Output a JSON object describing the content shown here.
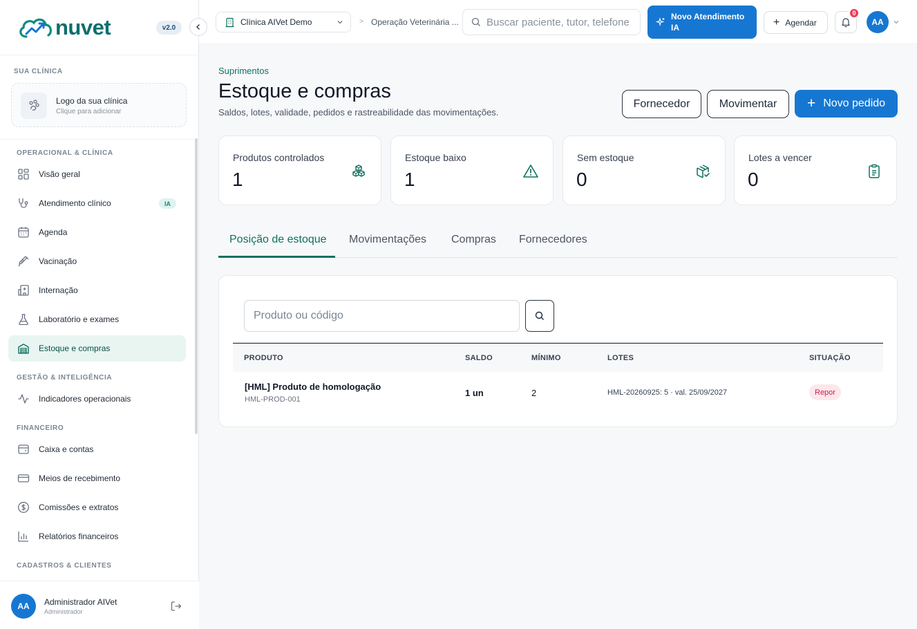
{
  "brand": {
    "name": "nuvet",
    "version": "v2.0"
  },
  "sidebar": {
    "clinic_section": "SUA CLÍNICA",
    "clinic_logo": {
      "title": "Logo da sua clínica",
      "subtitle": "Clique para adicionar"
    },
    "sections": [
      {
        "label": "OPERACIONAL & CLÍNICA",
        "items": [
          {
            "label": "Visão geral",
            "icon": "grid-icon"
          },
          {
            "label": "Atendimento clínico",
            "icon": "stethoscope-icon",
            "badge": "IA"
          },
          {
            "label": "Agenda",
            "icon": "calendar-icon"
          },
          {
            "label": "Vacinação",
            "icon": "syringe-icon"
          },
          {
            "label": "Internação",
            "icon": "hospital-icon"
          },
          {
            "label": "Laboratório e exames",
            "icon": "flask-icon"
          },
          {
            "label": "Estoque e compras",
            "icon": "warehouse-icon",
            "active": true
          }
        ]
      },
      {
        "label": "GESTÃO & INTELIGÊNCIA",
        "items": [
          {
            "label": "Indicadores operacionais",
            "icon": "activity-icon"
          }
        ]
      },
      {
        "label": "FINANCEIRO",
        "items": [
          {
            "label": "Caixa e contas",
            "icon": "wallet-icon"
          },
          {
            "label": "Meios de recebimento",
            "icon": "credit-card-icon"
          },
          {
            "label": "Comissões e extratos",
            "icon": "dollar-circle-icon"
          },
          {
            "label": "Relatórios financeiros",
            "icon": "bar-chart-icon"
          }
        ]
      },
      {
        "label": "CADASTROS & CLIENTES",
        "items": []
      }
    ],
    "user": {
      "initials": "AA",
      "name": "Administrador AIVet",
      "role": "Administrador"
    }
  },
  "topbar": {
    "clinic": "Clínica AIVet Demo",
    "breadcrumb_sep": ">",
    "breadcrumb": "Operação Veterinária ...",
    "search_placeholder": "Buscar paciente, tutor, telefone",
    "new_ia_button": "Novo Atendimento IA",
    "schedule_button": "Agendar",
    "notifications": "0",
    "avatar": "AA"
  },
  "page": {
    "section": "Suprimentos",
    "title": "Estoque e compras",
    "subtitle": "Saldos, lotes, validade, pedidos e rastreabilidade das movimentações.",
    "buttons": {
      "supplier": "Fornecedor",
      "move": "Movimentar",
      "new_order": "Novo pedido"
    }
  },
  "kpis": [
    {
      "label": "Produtos controlados",
      "value": "1",
      "icon": "cubes-icon"
    },
    {
      "label": "Estoque baixo",
      "value": "1",
      "icon": "alert-triangle-icon"
    },
    {
      "label": "Sem estoque",
      "value": "0",
      "icon": "package-check-icon"
    },
    {
      "label": "Lotes a vencer",
      "value": "0",
      "icon": "clipboard-icon"
    }
  ],
  "tabs": [
    "Posição de estoque",
    "Movimentações",
    "Compras",
    "Fornecedores"
  ],
  "table": {
    "search_placeholder": "Produto ou código",
    "headers": [
      "PRODUTO",
      "SALDO",
      "MÍNIMO",
      "LOTES",
      "SITUAÇÃO"
    ],
    "rows": [
      {
        "name": "[HML] Produto de homologação",
        "code": "HML-PROD-001",
        "balance": "1 un",
        "minimum": "2",
        "lots": "HML-20260925: 5 · val. 25/09/2027",
        "status": "Repor"
      }
    ]
  },
  "colors": {
    "accent": "#10705f",
    "primary": "#1677d2",
    "danger": "#c81e4b",
    "active_bg": "#e8f5f1"
  }
}
